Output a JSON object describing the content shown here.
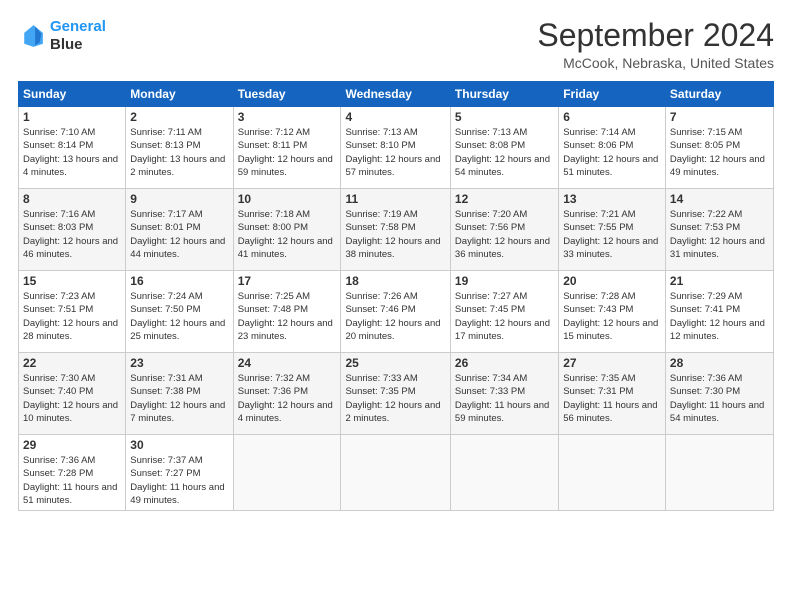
{
  "logo": {
    "line1": "General",
    "line2": "Blue"
  },
  "title": "September 2024",
  "location": "McCook, Nebraska, United States",
  "days_header": [
    "Sunday",
    "Monday",
    "Tuesday",
    "Wednesday",
    "Thursday",
    "Friday",
    "Saturday"
  ],
  "weeks": [
    [
      {
        "day": "1",
        "sunrise": "7:10 AM",
        "sunset": "8:14 PM",
        "daylight": "13 hours and 4 minutes."
      },
      {
        "day": "2",
        "sunrise": "7:11 AM",
        "sunset": "8:13 PM",
        "daylight": "13 hours and 2 minutes."
      },
      {
        "day": "3",
        "sunrise": "7:12 AM",
        "sunset": "8:11 PM",
        "daylight": "12 hours and 59 minutes."
      },
      {
        "day": "4",
        "sunrise": "7:13 AM",
        "sunset": "8:10 PM",
        "daylight": "12 hours and 57 minutes."
      },
      {
        "day": "5",
        "sunrise": "7:13 AM",
        "sunset": "8:08 PM",
        "daylight": "12 hours and 54 minutes."
      },
      {
        "day": "6",
        "sunrise": "7:14 AM",
        "sunset": "8:06 PM",
        "daylight": "12 hours and 51 minutes."
      },
      {
        "day": "7",
        "sunrise": "7:15 AM",
        "sunset": "8:05 PM",
        "daylight": "12 hours and 49 minutes."
      }
    ],
    [
      {
        "day": "8",
        "sunrise": "7:16 AM",
        "sunset": "8:03 PM",
        "daylight": "12 hours and 46 minutes."
      },
      {
        "day": "9",
        "sunrise": "7:17 AM",
        "sunset": "8:01 PM",
        "daylight": "12 hours and 44 minutes."
      },
      {
        "day": "10",
        "sunrise": "7:18 AM",
        "sunset": "8:00 PM",
        "daylight": "12 hours and 41 minutes."
      },
      {
        "day": "11",
        "sunrise": "7:19 AM",
        "sunset": "7:58 PM",
        "daylight": "12 hours and 38 minutes."
      },
      {
        "day": "12",
        "sunrise": "7:20 AM",
        "sunset": "7:56 PM",
        "daylight": "12 hours and 36 minutes."
      },
      {
        "day": "13",
        "sunrise": "7:21 AM",
        "sunset": "7:55 PM",
        "daylight": "12 hours and 33 minutes."
      },
      {
        "day": "14",
        "sunrise": "7:22 AM",
        "sunset": "7:53 PM",
        "daylight": "12 hours and 31 minutes."
      }
    ],
    [
      {
        "day": "15",
        "sunrise": "7:23 AM",
        "sunset": "7:51 PM",
        "daylight": "12 hours and 28 minutes."
      },
      {
        "day": "16",
        "sunrise": "7:24 AM",
        "sunset": "7:50 PM",
        "daylight": "12 hours and 25 minutes."
      },
      {
        "day": "17",
        "sunrise": "7:25 AM",
        "sunset": "7:48 PM",
        "daylight": "12 hours and 23 minutes."
      },
      {
        "day": "18",
        "sunrise": "7:26 AM",
        "sunset": "7:46 PM",
        "daylight": "12 hours and 20 minutes."
      },
      {
        "day": "19",
        "sunrise": "7:27 AM",
        "sunset": "7:45 PM",
        "daylight": "12 hours and 17 minutes."
      },
      {
        "day": "20",
        "sunrise": "7:28 AM",
        "sunset": "7:43 PM",
        "daylight": "12 hours and 15 minutes."
      },
      {
        "day": "21",
        "sunrise": "7:29 AM",
        "sunset": "7:41 PM",
        "daylight": "12 hours and 12 minutes."
      }
    ],
    [
      {
        "day": "22",
        "sunrise": "7:30 AM",
        "sunset": "7:40 PM",
        "daylight": "12 hours and 10 minutes."
      },
      {
        "day": "23",
        "sunrise": "7:31 AM",
        "sunset": "7:38 PM",
        "daylight": "12 hours and 7 minutes."
      },
      {
        "day": "24",
        "sunrise": "7:32 AM",
        "sunset": "7:36 PM",
        "daylight": "12 hours and 4 minutes."
      },
      {
        "day": "25",
        "sunrise": "7:33 AM",
        "sunset": "7:35 PM",
        "daylight": "12 hours and 2 minutes."
      },
      {
        "day": "26",
        "sunrise": "7:34 AM",
        "sunset": "7:33 PM",
        "daylight": "11 hours and 59 minutes."
      },
      {
        "day": "27",
        "sunrise": "7:35 AM",
        "sunset": "7:31 PM",
        "daylight": "11 hours and 56 minutes."
      },
      {
        "day": "28",
        "sunrise": "7:36 AM",
        "sunset": "7:30 PM",
        "daylight": "11 hours and 54 minutes."
      }
    ],
    [
      {
        "day": "29",
        "sunrise": "7:36 AM",
        "sunset": "7:28 PM",
        "daylight": "11 hours and 51 minutes."
      },
      {
        "day": "30",
        "sunrise": "7:37 AM",
        "sunset": "7:27 PM",
        "daylight": "11 hours and 49 minutes."
      },
      null,
      null,
      null,
      null,
      null
    ]
  ],
  "labels": {
    "sunrise": "Sunrise: ",
    "sunset": "Sunset: ",
    "daylight": "Daylight: "
  }
}
